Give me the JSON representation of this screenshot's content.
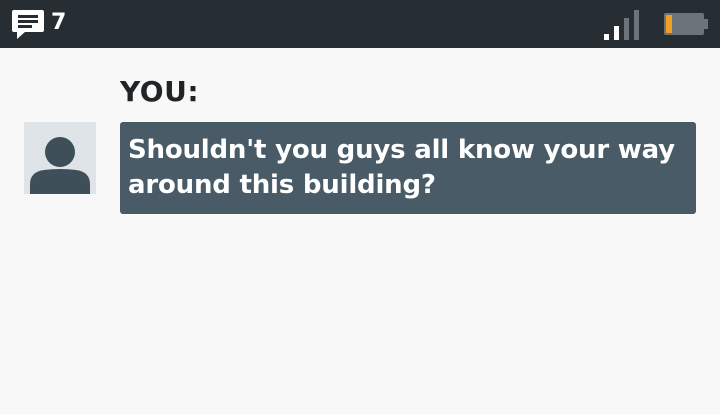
{
  "status_bar": {
    "message_count": "7",
    "icons": {
      "messages": "chat-bubble-icon",
      "signal": "signal-strength-icon",
      "battery": "battery-low-icon"
    },
    "colors": {
      "background": "#262d33",
      "battery_level": "#f0a020",
      "signal_active": "#ffffff",
      "signal_inactive": "#6b747a"
    }
  },
  "conversation": {
    "speaker": "YOU:",
    "avatar_icon": "person-silhouette-icon",
    "message": "Shouldn't you guys all know your way around this building?",
    "colors": {
      "bubble": "#485b66",
      "avatar_bg": "#dfe4e9",
      "avatar_figure": "#3f4f5a"
    }
  }
}
